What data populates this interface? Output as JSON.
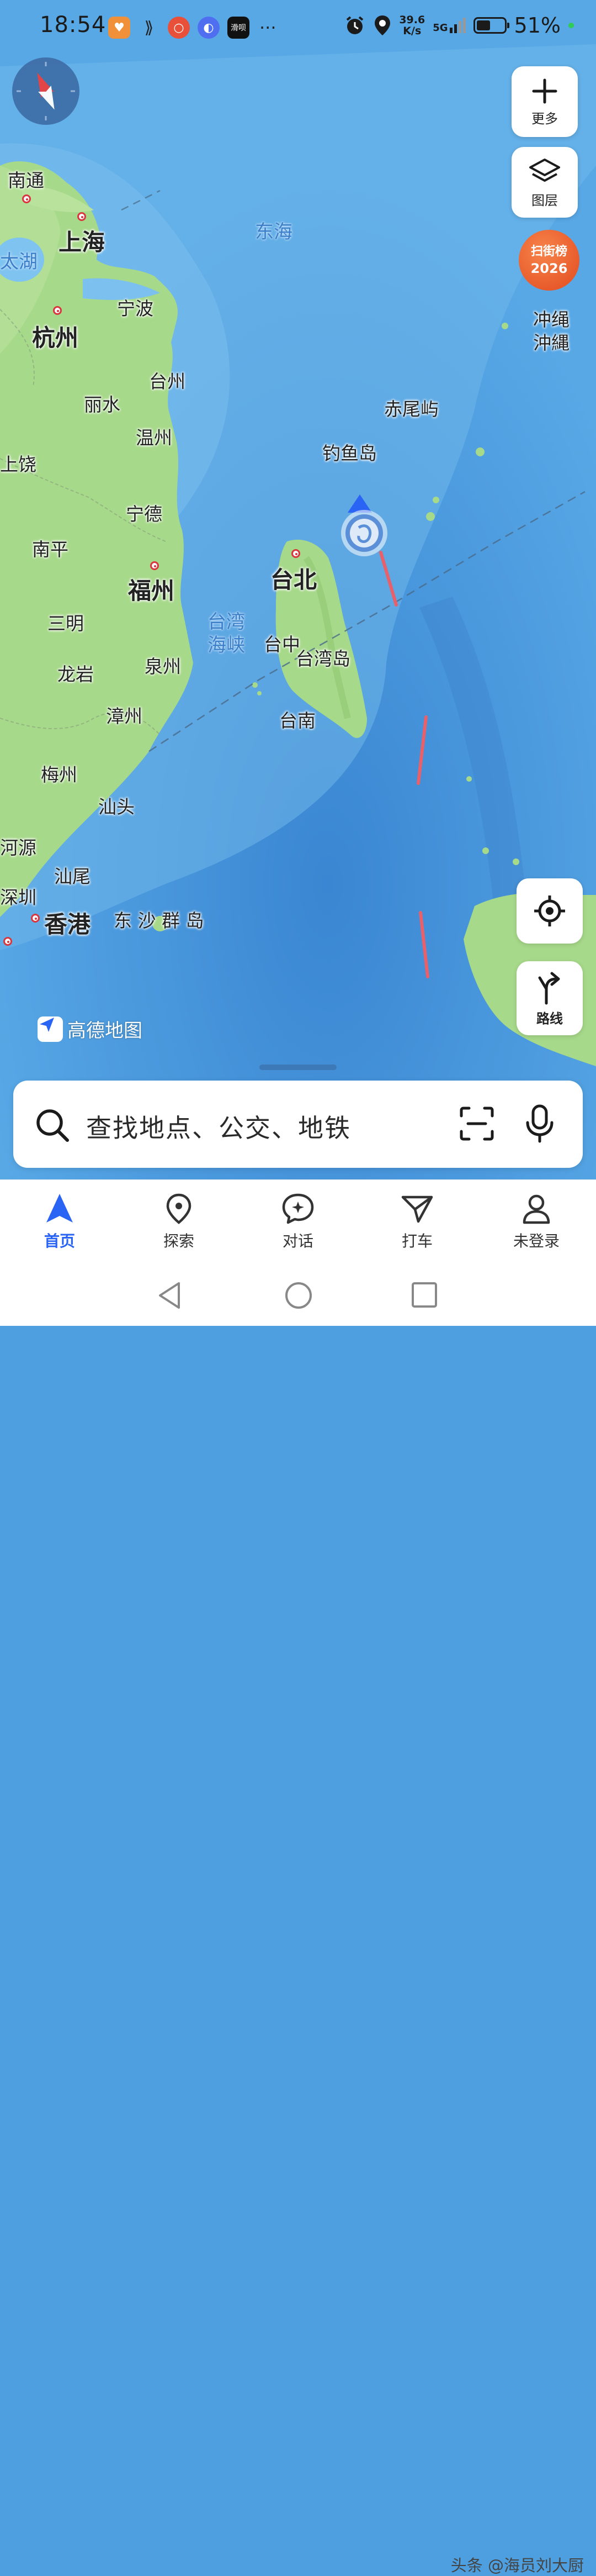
{
  "status_bar": {
    "time": "18:54",
    "app_icons": [
      "taobao-icon",
      "link-icon",
      "search-app-icon",
      "browser-icon",
      "news-app-icon"
    ],
    "news_icon_text": "滑呗",
    "dots": "···",
    "net_speed_value": "39.6",
    "net_speed_unit": "K/s",
    "network_type": "5G",
    "battery_percent_label": "51%",
    "battery_level": 0.51
  },
  "map": {
    "cities": {
      "nantong": "南通",
      "shanghai": "上海",
      "taihu": "太湖",
      "ningbo": "宁波",
      "hangzhou": "杭州",
      "taizhou": "台州",
      "lishui": "丽水",
      "wenzhou": "温州",
      "shangrao": "上饶",
      "ningde": "宁德",
      "nanping": "南平",
      "fuzhou": "福州",
      "sanming": "三明",
      "longyan": "龙岩",
      "quanzhou": "泉州",
      "zhangzhou": "漳州",
      "meizhou": "梅州",
      "shantou": "汕头",
      "heyuan": "河源",
      "shanwei": "汕尾",
      "shenzhen": "深圳",
      "hongkong": "香港",
      "taipei": "台北",
      "taichung": "台中",
      "tainan": "台南",
      "okinawa_1": "冲绳",
      "okinawa_2": "沖縄"
    },
    "features": {
      "east_china_sea": "东海",
      "chiwei_island": "赤尾屿",
      "diaoyu_island": "钓鱼岛",
      "taiwan_strait_1": "台湾",
      "taiwan_strait_2": "海峡",
      "taiwan_island": "台湾岛",
      "dongsha_islands": "东 沙 群 岛"
    },
    "logo_text": "高德地图",
    "colors": {
      "sea": "#4d9fe0",
      "land": "#a7d98a",
      "typhoon_track": "#e8606a",
      "accent": "#2a64f5"
    }
  },
  "controls": {
    "more_label": "更多",
    "layers_label": "图层",
    "rank_badge_line1": "扫街榜",
    "rank_badge_line2": "2026",
    "route_label": "路线"
  },
  "search": {
    "placeholder": "查找地点、公交、地铁"
  },
  "bottom_nav": {
    "items": [
      {
        "label": "首页",
        "icon": "navigation-arrow-icon",
        "active": true
      },
      {
        "label": "探索",
        "icon": "location-pin-icon",
        "active": false
      },
      {
        "label": "对话",
        "icon": "chat-bubble-icon",
        "active": false
      },
      {
        "label": "打车",
        "icon": "taxi-icon",
        "active": false
      },
      {
        "label": "未登录",
        "icon": "user-icon",
        "active": false
      }
    ]
  },
  "watermark": "头条 @海员刘大厨"
}
